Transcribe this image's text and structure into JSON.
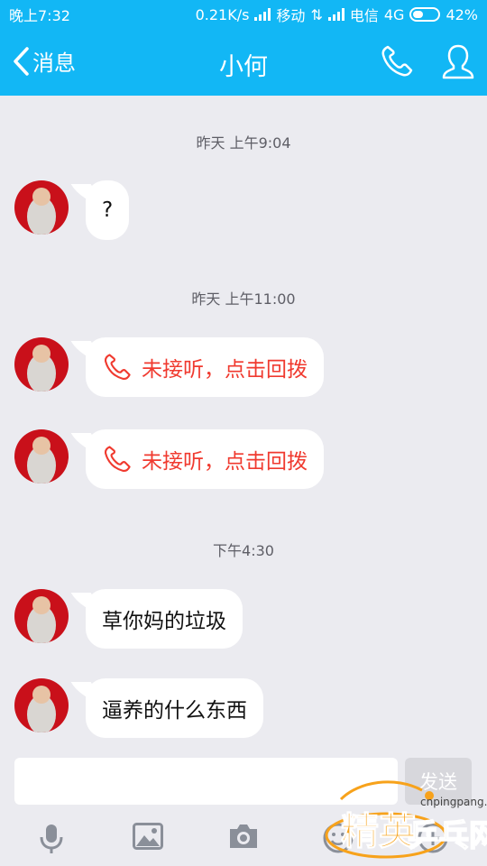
{
  "status_bar": {
    "time": "晚上7:32",
    "speed": "0.21K/s",
    "carrier1": "移动",
    "carrier2": "电信",
    "network": "4G",
    "battery": "42%",
    "battery_level": 0.42
  },
  "header": {
    "back_label": "消息",
    "title": "小何",
    "accent_color": "#12b7f5"
  },
  "messages": [
    {
      "type": "timestamp",
      "text": "昨天 上午9:04"
    },
    {
      "type": "text",
      "text": "?"
    },
    {
      "type": "timestamp",
      "text": "昨天 上午11:00"
    },
    {
      "type": "missed_call",
      "text": "未接听，点击回拨",
      "color": "#f03a2f"
    },
    {
      "type": "missed_call",
      "text": "未接听，点击回拨",
      "color": "#f03a2f"
    },
    {
      "type": "timestamp",
      "text": "下午4:30"
    },
    {
      "type": "text",
      "text": "草你妈的垃圾"
    },
    {
      "type": "text",
      "text": "逼养的什么东西"
    }
  ],
  "input": {
    "placeholder": "",
    "send_label": "发送"
  },
  "toolbar": {
    "icons": [
      "microphone-icon",
      "image-icon",
      "camera-icon",
      "emoji-icon",
      "more-icon"
    ]
  },
  "watermark": {
    "url": "cnpingpang.com",
    "text1": "精英",
    "text2": "乒乓网"
  }
}
